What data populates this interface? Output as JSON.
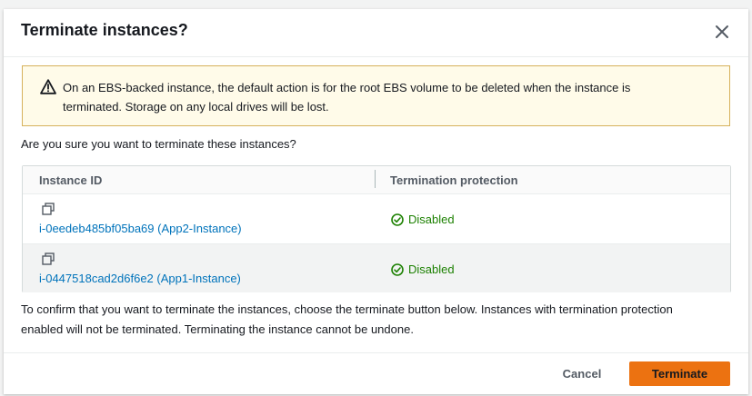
{
  "dialog": {
    "title": "Terminate instances?",
    "warning": "On an EBS-backed instance, the default action is for the root EBS volume to be deleted when the instance is terminated. Storage on any local drives will be lost.",
    "question": "Are you sure you want to terminate these instances?",
    "confirm_text": "To confirm that you want to terminate the instances, choose the terminate button below. Instances with termination protection enabled will not be terminated. Terminating the instance cannot be undone."
  },
  "table": {
    "columns": [
      "Instance ID",
      "Termination protection"
    ],
    "rows": [
      {
        "instance": "i-0eedeb485bf05ba69 (App2-Instance)",
        "protection": "Disabled"
      },
      {
        "instance": "i-0447518cad2d6f6e2 (App1-Instance)",
        "protection": "Disabled"
      }
    ]
  },
  "footer": {
    "cancel_label": "Cancel",
    "terminate_label": "Terminate"
  },
  "colors": {
    "primary": "#ec7211",
    "link": "#0073bb",
    "success": "#1d8102",
    "warning_bg": "#fffbe9"
  }
}
